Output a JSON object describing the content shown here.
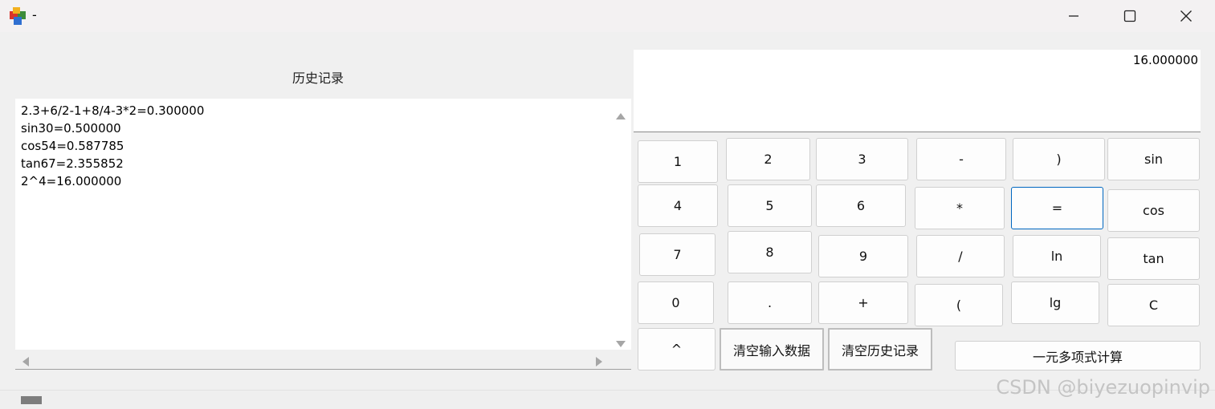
{
  "window": {
    "title": "-",
    "minimize_icon": "minimize-icon",
    "maximize_icon": "maximize-icon",
    "close_icon": "close-icon"
  },
  "history": {
    "label": "历史记录",
    "lines": [
      "2.3+6/2-1+8/4-3*2=0.300000",
      "sin30=0.500000",
      "cos54=0.587785",
      "tan67=2.355852",
      "2^4=16.000000"
    ]
  },
  "display": {
    "value": "16.000000"
  },
  "keys": {
    "k1": "1",
    "k2": "2",
    "k3": "3",
    "minus": "-",
    "rparen": ")",
    "sin": "sin",
    "k4": "4",
    "k5": "5",
    "k6": "6",
    "mul": "*",
    "equals": "=",
    "cos": "cos",
    "k7": "7",
    "k8": "8",
    "k9": "9",
    "div": "/",
    "ln": "ln",
    "tan": "tan",
    "k0": "0",
    "dot": ".",
    "plus": "+",
    "lparen": "(",
    "lg": "lg",
    "clear": "C",
    "pow": "^",
    "clear_input": "清空输入数据",
    "clear_history": "清空历史记录",
    "polynomial": "一元多项式计算"
  },
  "watermark": "CSDN @biyezuopinvip"
}
